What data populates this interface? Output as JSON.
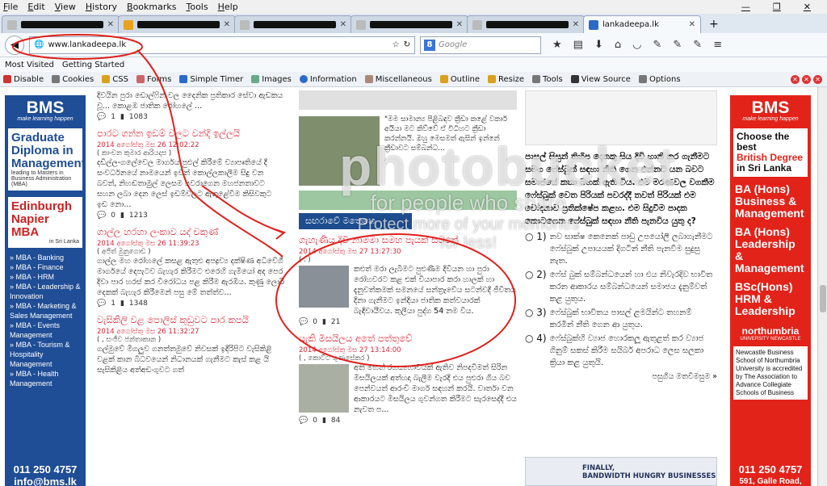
{
  "menubar": {
    "items": [
      "File",
      "Edit",
      "View",
      "History",
      "Bookmarks",
      "Tools",
      "Help"
    ],
    "min": "—",
    "max": "❐",
    "close": "✕"
  },
  "tabs": {
    "active_title": "lankadeepa.lk",
    "new_tab": "+"
  },
  "nav": {
    "url": "www.lankadeepa.lk",
    "search_placeholder": "Google"
  },
  "bookmarks": [
    "Most Visited",
    "Getting Started"
  ],
  "devbar": [
    "Disable",
    "Cookies",
    "CSS",
    "Forms",
    "Simple Timer",
    "Images",
    "Information",
    "Miscellaneous",
    "Outline",
    "Resize",
    "Tools",
    "View Source",
    "Options"
  ],
  "left_ad": {
    "brand": "BMS",
    "tagline": "make learning happen",
    "heading1": "Graduate Diploma in Management",
    "sub1": "leading to Masters in Business Administration (MBA)",
    "heading2": "Edinburgh Napier MBA",
    "sub2": "in Sri Lanka",
    "programs": [
      "MBA - Banking",
      "MBA - Finance",
      "MBA - HRM",
      "MBA - Leadership & Innovation",
      "MBA - Marketing & Sales Management",
      "MBA - Events Management",
      "MBA - Tourism & Hospitality Management",
      "MBA - Health Management"
    ],
    "phone": "011 250 4757",
    "email": "info@bms.lk"
  },
  "right_ad": {
    "brand": "BMS",
    "tagline": "make learning happen",
    "choose1": "Choose the best",
    "choose2": "British Degree",
    "choose3": "in Sri Lanka",
    "prog1": "BA (Hons) Business & Management",
    "prog2": "BA (Hons) Leadership & Management",
    "prog3": "BSc(Hons) HRM & Leadership",
    "uni": "northumbria",
    "uni_sub": "UNIVERSITY NEWCASTLE",
    "note": "Newcastle Business School of Northumbria University is accredited by The Association to Advance Collegiate Schools of Business",
    "phone": "011 250 4757",
    "address": "591, Galle Road,"
  },
  "col1": [
    {
      "title": "",
      "date": "",
      "by": "",
      "text": "දිවයින පුරා ඩොල්ෆින් වල දෛනික ප්‍රතිකාර සේවා ඇඩකය වූ... කොළඹ ජාතික රෝහලේ ...",
      "comments": "1",
      "views": "1083"
    },
    {
      "title": "පාරට ගන්න ඉඩම් වලට වන්දි ඉල්ලයි",
      "date": "2014 අගෝස්තු මස 26 12:02:22",
      "by": "( කාංචන කුමාර ආරියදාස )",
      "text": "දඩිල්ල-ගලේවෙල මාර්ගය පුළුල් කිරීමේ ව්‍යාපෘතියේ දී සංවර්ධනයේ නාමයෙන් ඉවත් කොල්ලකාලීම සිදු වන බවත්, නිහඬතාමුල් ලෙසම පවරාගෙන මහජනතාවට සහන ලබා දෙන ලෙස් ඉඩම්වලට ඇතුළේවීම කිසිවකුට ඉඩ නො...",
      "comments": "0",
      "views": "1213"
    },
    {
      "title": "ගාල්ල හරහා ලංකාව යද් චකුණ්",
      "date": "2014 අගෝස්තු මස 26 11:39:23",
      "by": "( අජිත් මුනුගොඩ )",
      "text": "ගාල්ල මහ රෝහලේ කසළ ඇතුළු අපද්‍රව්‍ය දක්ෂිණ අධිවේගී මාර්ගයේ දෙපැටව බැහැර කිරීමට එරෙහි ගැමියෝ අද පෙර දිවා පාර හරස් කර විරෝධය පළ කිරීම ඇරඹීය. කුණු ලොරි දෙකක් බැහැර කිරීමෙන් පසු මේ තත්ත්ව...",
      "comments": "1",
      "views": "1348"
    },
    {
      "title": "වැසිකිලි වළ පොලිස් කුඩුවට පාර කපයි",
      "date": "2014 අගෝස්තු මස 26 11:32:27",
      "by": "( , සංජීව ජන්තාකාන )",
      "text": "ගල්මුවේ මීගලුව ගනත්තමුවේ නිවසක් ඉදිරිපිට වැසිකිළි වළක් කාන බිධවයෙන් නිධානයක් ගැනීමට කැස් කළ යි සැසිකිළිය අත්අඩංගුවට ගත්",
      "comments": "",
      "views": ""
    }
  ],
  "col2": {
    "quote": "\"මම සාමාන්‍ය පිළිබඳව ක්‍රීඩා කළේ වකාර් අයියා මට කිව්වේ ඒ විධිහට ක්‍රීඩා කරන්නයි. ඔහු මෙසමත් ඇසින් ඉන්නේ ක්‍රීඩාවට සම්බන්ධ...",
    "section": "සඟරාවේ මතෙහෙ",
    "a1": {
      "title": "ගැහැණිය දිවි නාමමා සමහ පැයක් සටනේ",
      "date": "2014 අගෝස්තු මස 27 13:27:30",
      "by": "( . )",
      "text": "කළුත් මරා ලැබීමට පුළුණීම දිවියන හා පුරා රෝහවරට කළ එක් වියාපාර කරා හාලක් හා දැනුවත්කමක් සමනයේ සන්ත්‍රෑවේය සටන්වදී ජීවිතය දිනා ගැනීමට ඉන්දියා ජාතික කත්වයාරක් බැඳිවායීවය. කුලීයා පුද්ග 54 නම විය.",
      "comments": "0",
      "views": "21"
    },
    "a2": {
      "title": "යැකි මිසයිලය අතේ පත්තුවේ",
      "date": "2014 අගෝස්තු මස 27 13:14:00",
      "by": "( , කොට්ට ගුණසේකර )",
      "text": "අති මහත් රහස්‍යභාවයක් ඇතිව නිපදවීමත් සිරින මිසයිලයක් අත්හදා බැලීම වැරදි එය පුළුරා ගිය බව පෙන්වයත් ආරංචි මාර්ග සඳහන් කරයි. වාර්තා වන ආකාරයට මිසයිලය ගුවන්ගත කිරීමට සැරසෙද්දී එය නැවත ප...",
      "comments": "0",
      "views": "84"
    }
  },
  "col3": {
    "intro": "පාසල් සිසුන් තිහිප දෙනකු සිය දිවි හානි කර ගැනීමට සමග ෆේස්බුක් සඳහා නීති ගෙන එන්නට යන බවට සමාජයේ කතා බහක් ඇති විය. එම මරණවල වගකීම ෆේස්බුක් වෙත පිරියක් පවරද්දී තවත් පිරියක් එම චෝදනාව ප්‍රතික්ෂේප කළහ. එම සිදුවීම පාදක කොටගෙන ෆේස්බුක් සඳහා නීති පැනවිය යුතු ද?",
    "options": [
      {
        "n": "1)",
        "text": "නව සාක්ෂ කෙනෙක් පාඩු උපයෝලී ලබාගැනීමට ෆේස්බුක් උපායයක් දිගටින් නීති පැනවීම සුදුසු නැත."
      },
      {
        "n": "2)",
        "text": "ෆේස් බුක් සම්බන්ධයෙන් හා එය නිවැරදිව භාවිත කරන ආකාරය සම්බන්ධයෙන් සමාජය දැනුම්වත් කළ යුතුය."
      },
      {
        "n": "3)",
        "text": "ෆේස්බුක් භාවිතය පාසල් ළමයින්ට තහනම් කරමින් නීති ගෙන ආ යුතුය."
      },
      {
        "n": "4)",
        "text": "ෆේස්බුක්හි ව්‍යාජ හොරකලූ ඇතුළත් කර ව්‍යාජ ගිනුම් සකස් කිරීම සයිබර් අපරාධ ලෙස සලකා ක්‍රියා කළ යුතුයි."
      }
    ],
    "more": "පසුගිය මතවිමසුම »",
    "banner_line1": "FINALLY,",
    "banner_line2": "BANDWIDTH HUNGRY BUSINESSES"
  },
  "watermark": {
    "brand": "photobucket",
    "line1": "for people who share",
    "line2": "Protect more of your memories",
    "line3": "for less!"
  }
}
